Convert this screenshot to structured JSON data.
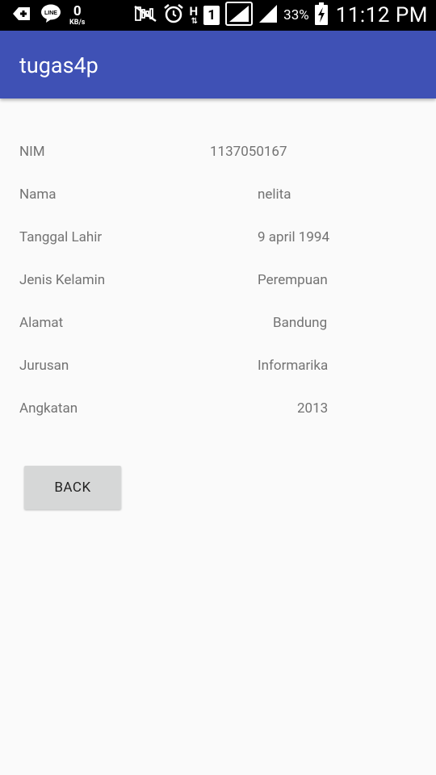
{
  "status_bar": {
    "net_speed_value": "0",
    "net_speed_unit": "KB/s",
    "network_type": "H",
    "sim_slot": "1",
    "battery_percent": "33%",
    "time": "11:12 PM",
    "icons": [
      "add-notification-icon",
      "line-app-icon",
      "mute-icon",
      "alarm-icon",
      "signal-icon",
      "signal-icon-2",
      "battery-charging-icon"
    ]
  },
  "appbar": {
    "title": "tugas4p",
    "background": "#3f51b5"
  },
  "details": [
    {
      "label": "NIM",
      "value": "1137050167"
    },
    {
      "label": "Nama",
      "value": "nelita"
    },
    {
      "label": "Tanggal Lahir",
      "value": "9 april 1994"
    },
    {
      "label": "Jenis Kelamin",
      "value": "Perempuan"
    },
    {
      "label": "Alamat",
      "value": "Bandung"
    },
    {
      "label": "Jurusan",
      "value": "Informarika"
    },
    {
      "label": "Angkatan",
      "value": "2013"
    }
  ],
  "back_button": {
    "label": "BACK"
  }
}
